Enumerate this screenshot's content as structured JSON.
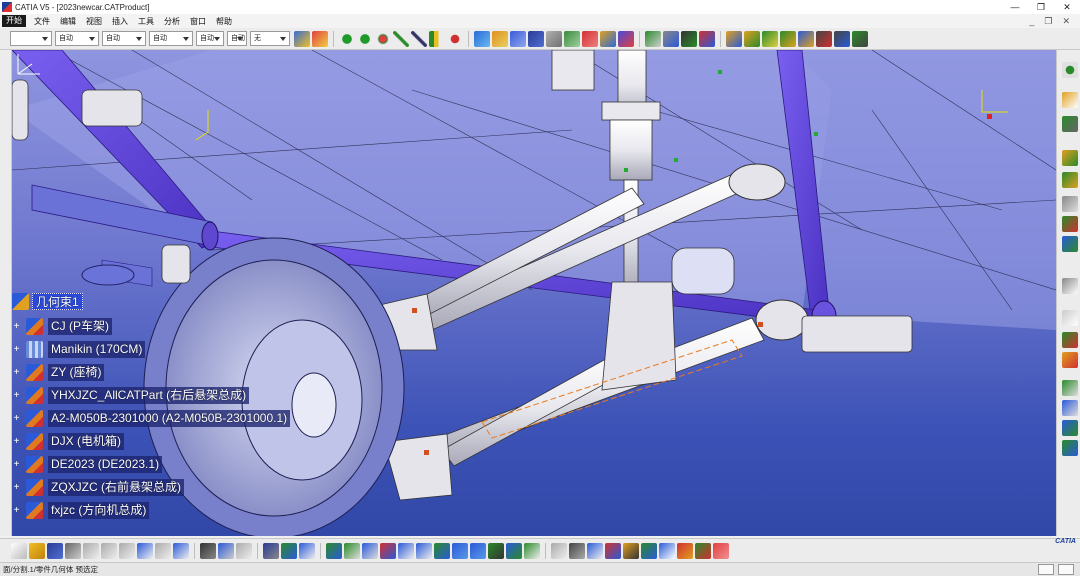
{
  "window": {
    "title": "CATIA V5 - [2023newcar.CATProduct]",
    "controls": [
      "—",
      "❐",
      "✕"
    ]
  },
  "menu": {
    "start": "开始",
    "items": [
      "文件",
      "编辑",
      "视图",
      "插入",
      "工具",
      "分析",
      "窗口",
      "帮助"
    ],
    "child_controls": [
      "_",
      "❐",
      "✕"
    ]
  },
  "toolbar": {
    "combos": [
      "",
      "自动",
      "自动",
      "自动",
      "自动",
      "自动",
      "无"
    ]
  },
  "tree": {
    "root": "几何束1",
    "items": [
      {
        "label": "CJ (P车架)",
        "icon": "product-icon"
      },
      {
        "label": "Manikin (170CM)",
        "icon": "manikin-icon"
      },
      {
        "label": "ZY (座椅)",
        "icon": "product-icon"
      },
      {
        "label": "YHXJZC_AllCATPart (右后悬架总成)",
        "icon": "product-icon"
      },
      {
        "label": "A2-M050B-2301000 (A2-M050B-2301000.1)",
        "icon": "product-icon"
      },
      {
        "label": "DJX (电机箱)",
        "icon": "product-icon"
      },
      {
        "label": "DE2023 (DE2023.1)",
        "icon": "product-icon"
      },
      {
        "label": "ZQXJZC (右前悬架总成)",
        "icon": "product-icon"
      },
      {
        "label": "fxjzc (方向机总成)",
        "icon": "product-icon"
      }
    ]
  },
  "status": {
    "text": "面/分割.1/零件几何体 预选定"
  },
  "brand": {
    "logo_text": "CATIA"
  },
  "colors": {
    "tree_highlight": "#2b49d8",
    "frame_purple": "#5a3fd0",
    "part_white": "#eeeeee",
    "background_top": "#8f95df",
    "background_bottom": "#3148a8"
  }
}
